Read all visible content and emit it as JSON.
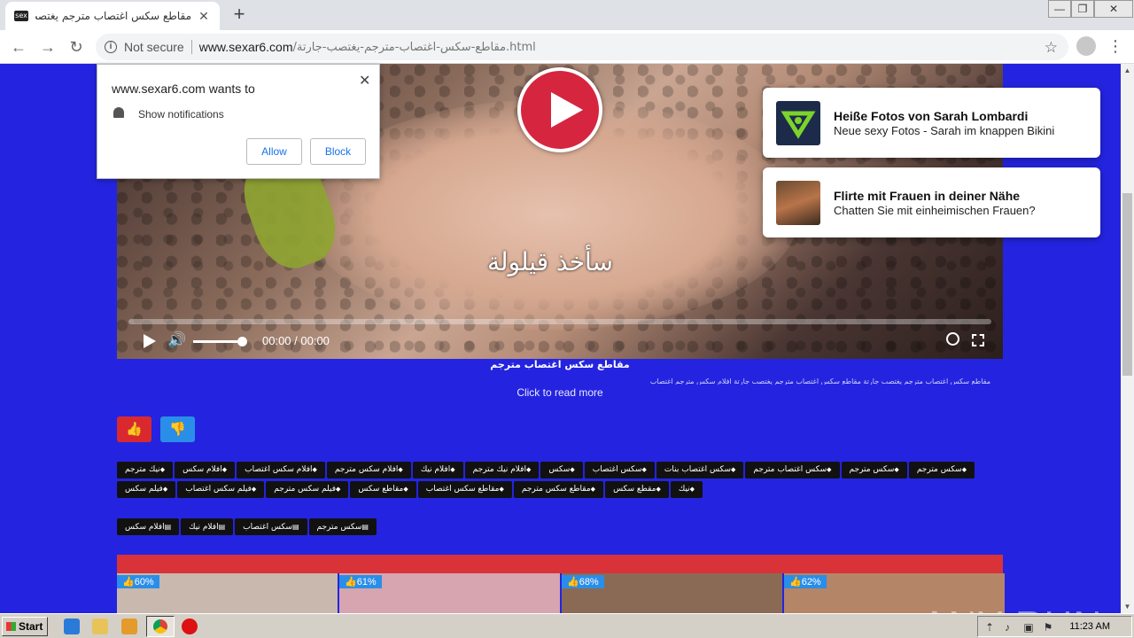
{
  "browser": {
    "tab_title": "مقاطع سكس اغتصاب مترجم يغتصب -",
    "tab_favicon_text": "sex",
    "url_status": "Not secure",
    "url_host": "www.sexar6.com",
    "url_path": "/مقاطع-سكس-اغتصاب-مترجم-يغتصب-جارتة.html"
  },
  "permission_popup": {
    "title": "www.sexar6.com wants to",
    "text": "Show notifications",
    "allow": "Allow",
    "block": "Block"
  },
  "video": {
    "subtitle": "سأخذ قيلولة",
    "time": "00:00 / 00:00"
  },
  "page": {
    "video_title": "مقاطع سكس اغتصاب مترجم",
    "description": "مقاطع سكس اغتصاب مترجم يغتصب جارتة مقاطع سكس اغتصاب مترجم يغتصب جارتة افلام سكس مترجم اغتصاب",
    "read_more": "Click to read more"
  },
  "push_notifications": [
    {
      "title": "Heiße Fotos von Sarah Lombardi",
      "body": "Neue sexy Fotos - Sarah im knappen Bikini"
    },
    {
      "title": "Flirte mit Frauen in deiner Nähe",
      "body": "Chatten Sie mit einheimischen Frauen?"
    }
  ],
  "tags": [
    "سكس مترجم",
    "سكس مترجم",
    "سكس اغتصاب مترجم",
    "سكس اغتصاب بنات",
    "سكس اغتصاب",
    "سكس",
    "افلام نيك مترجم",
    "افلام نيك",
    "افلام سكس مترجم",
    "افلام سكس اغتصاب",
    "افلام سكس",
    "نيك مترجم",
    "نيك",
    "مقطع سكس",
    "مقاطع سكس مترجم",
    "مقاطع سكس اغتصاب",
    "مقاطع سكس",
    "فيلم سكس مترجم",
    "فيلم سكس اغتصاب",
    "فيلم سكس"
  ],
  "categories": [
    "سكس مترجم",
    "سكس اغتصاب",
    "افلام نيك",
    "افلام سكس"
  ],
  "thumbnails": [
    {
      "rating": "60%",
      "color": "#c9b8ad"
    },
    {
      "rating": "61%",
      "color": "#d7a5b0"
    },
    {
      "rating": "68%",
      "color": "#8a6a55"
    },
    {
      "rating": "62%",
      "color": "#b58568"
    }
  ],
  "watermark": "ANY RUN",
  "taskbar": {
    "start": "Start",
    "time": "11:23 AM"
  }
}
